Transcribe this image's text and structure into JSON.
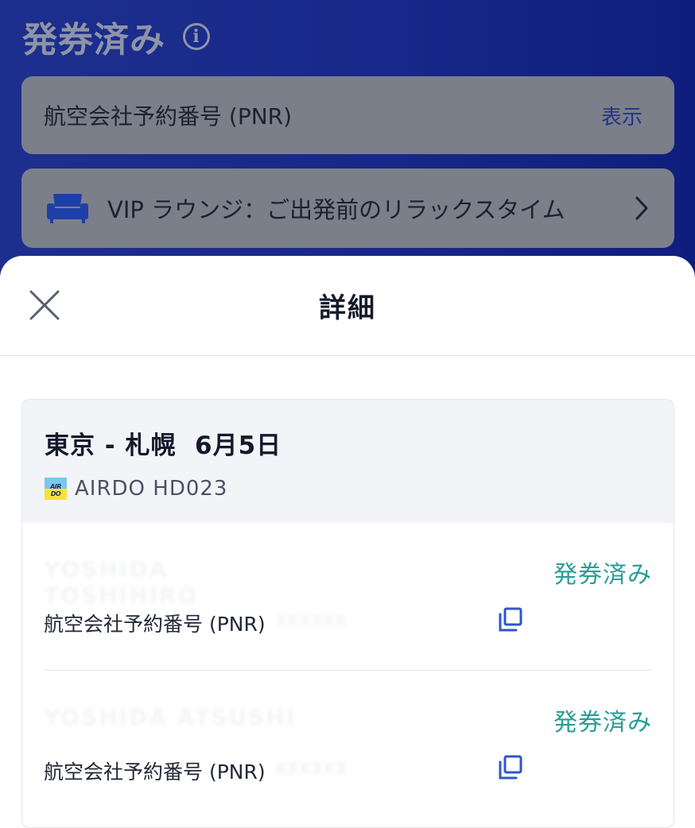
{
  "background": {
    "title": "発券済み",
    "pnr_label": "航空会社予約番号 (PNR)",
    "show_label": "表示",
    "vip_label": "VIP ラウンジ：ご出発前のリラックスタイム"
  },
  "sheet": {
    "title": "詳細",
    "route": "東京 - 札幌  6月5日",
    "airline": "AIRDO HD023",
    "airline_logo_text": "AIR DO",
    "passengers": [
      {
        "name": "YOSHIDA TOSHIHIRO",
        "status": "発券済み",
        "pnr_label": "航空会社予約番号 (PNR)",
        "pnr_value": "XXXXXX"
      },
      {
        "name": "YOSHIDA ATSUSHI",
        "status": "発券済み",
        "pnr_label": "航空会社予約番号 (PNR)",
        "pnr_value": "XXXXXX"
      }
    ]
  },
  "colors": {
    "accent_teal": "#2a9d96",
    "copy_blue": "#2f55c8",
    "background_navy": "#17288a"
  }
}
